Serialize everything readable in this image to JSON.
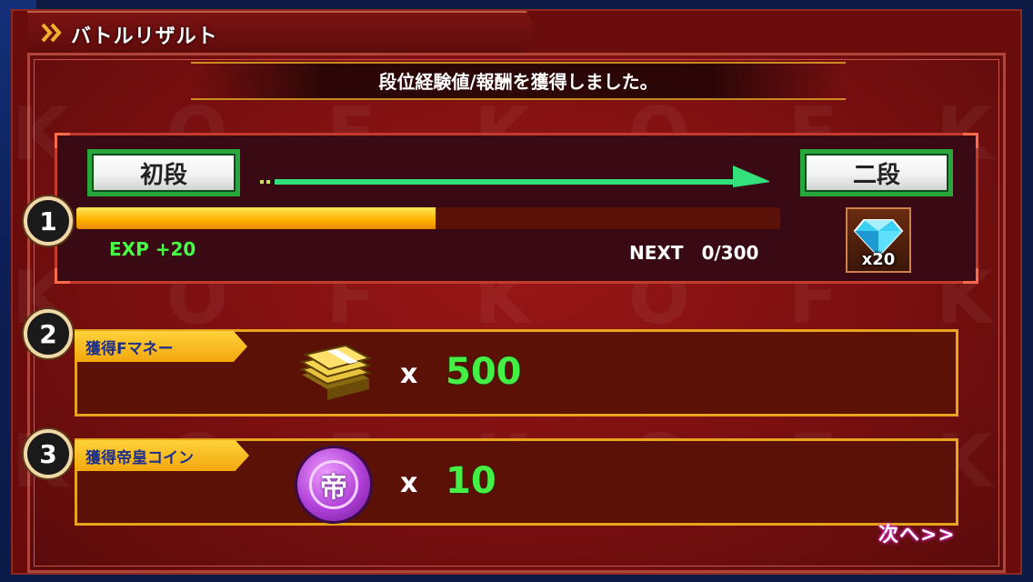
{
  "header": {
    "title": "バトルリザルト"
  },
  "subtitle": "段位経験値/報酬を獲得しました。",
  "rank": {
    "current": "初段",
    "next": "二段",
    "exp_label": "EXP +20",
    "next_label": "NEXT　0/300",
    "progress_fraction": 0.51,
    "reward_icon": "diamond-gem-icon",
    "reward_count": "x20"
  },
  "badges": [
    "1",
    "2",
    "3"
  ],
  "rewards": [
    {
      "label": "獲得Fマネー",
      "icon": "money-stack-icon",
      "x": "x",
      "value": "500"
    },
    {
      "label": "獲得帝皇コイン",
      "icon": "emperor-coin-icon",
      "coin_char": "帝",
      "x": "x",
      "value": "10"
    }
  ],
  "next_button": "次へ>>",
  "colors": {
    "accent_gold": "#e8a41c",
    "value_green": "#44f044",
    "rank_button_border": "#28a83c",
    "exp_fill": "#ffb400"
  }
}
